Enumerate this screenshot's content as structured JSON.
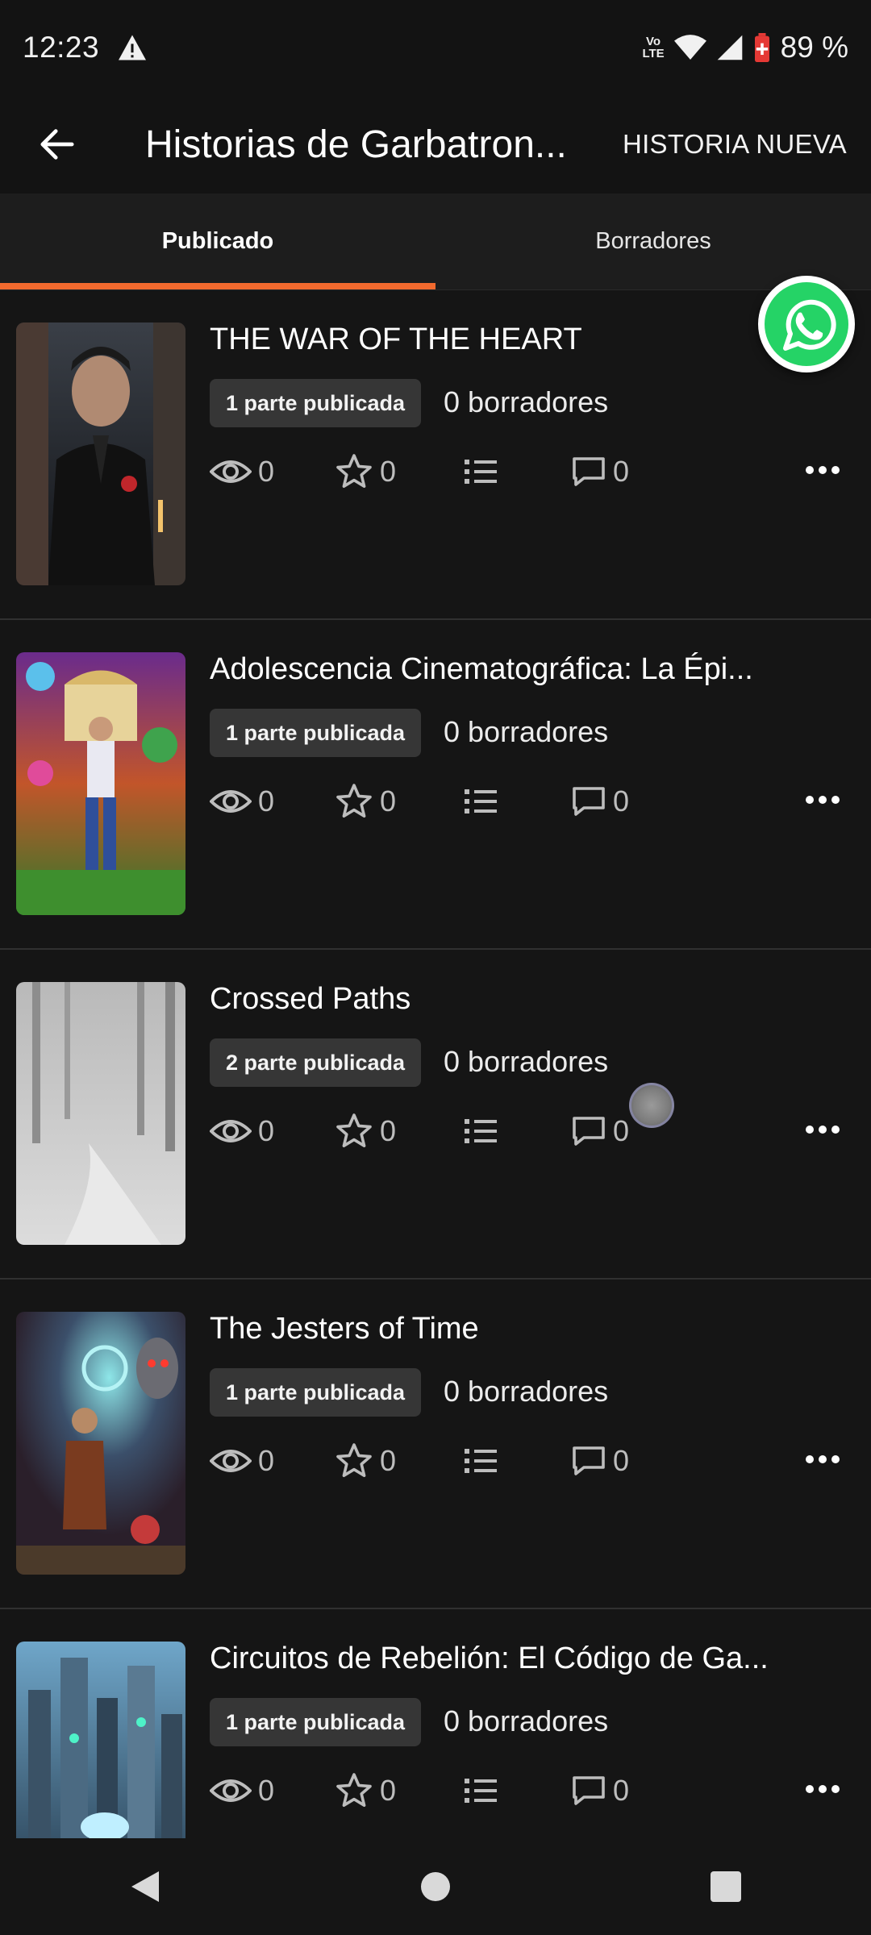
{
  "status_bar": {
    "time": "12:23",
    "network": "Vo LTE",
    "network_top": "Vo",
    "network_bottom": "LTE",
    "battery_percent": "89 %"
  },
  "app_bar": {
    "title": "Historias de Garbatron...",
    "new_story_label": "HISTORIA NUEVA"
  },
  "tabs": [
    {
      "label": "Publicado",
      "active": true
    },
    {
      "label": "Borradores",
      "active": false
    }
  ],
  "accent_color": "#f26a2e",
  "stories": [
    {
      "title": "THE WAR OF THE HEART",
      "published_badge": "1 parte publicada",
      "drafts": "0 borradores",
      "reads": "0",
      "votes": "0",
      "comments": "0"
    },
    {
      "title": "Adolescencia Cinematográfica: La Épi...",
      "published_badge": "1 parte publicada",
      "drafts": "0 borradores",
      "reads": "0",
      "votes": "0",
      "comments": "0"
    },
    {
      "title": "Crossed Paths",
      "published_badge": "2 parte publicada",
      "drafts": "0 borradores",
      "reads": "0",
      "votes": "0",
      "comments": "0"
    },
    {
      "title": "The Jesters of Time",
      "published_badge": "1 parte publicada",
      "drafts": "0 borradores",
      "reads": "0",
      "votes": "0",
      "comments": "0"
    },
    {
      "title": "Circuitos de Rebelión: El Código de Ga...",
      "published_badge": "1 parte publicada",
      "drafts": "0 borradores",
      "reads": "0",
      "votes": "0",
      "comments": "0"
    }
  ],
  "icons": {
    "back": "arrow-left-icon",
    "reads": "eye-icon",
    "votes": "star-icon",
    "parts": "list-icon",
    "comments": "comment-icon",
    "more": "more-horizontal-icon",
    "whatsapp": "whatsapp-icon",
    "nav_back": "triangle-back-icon",
    "nav_home": "circle-home-icon",
    "nav_recents": "square-recents-icon"
  }
}
